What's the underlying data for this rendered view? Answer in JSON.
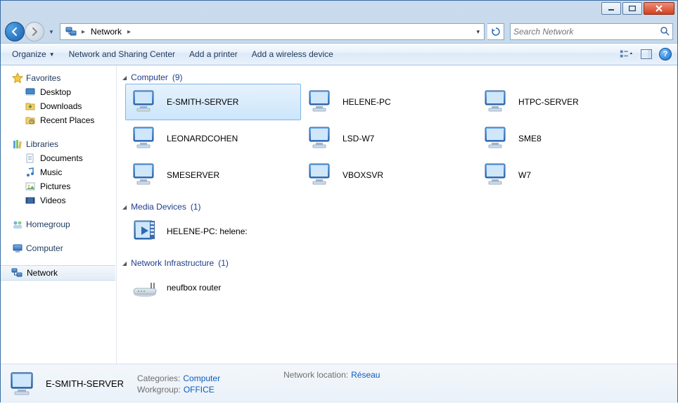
{
  "window": {
    "title": "Network"
  },
  "address": {
    "location": "Network"
  },
  "search": {
    "placeholder": "Search Network"
  },
  "toolbar": {
    "organize": "Organize",
    "nsc": "Network and Sharing Center",
    "add_printer": "Add a printer",
    "add_wireless": "Add a wireless device"
  },
  "sidebar": {
    "favorites": "Favorites",
    "favorites_items": [
      "Desktop",
      "Downloads",
      "Recent Places"
    ],
    "libraries": "Libraries",
    "libraries_items": [
      "Documents",
      "Music",
      "Pictures",
      "Videos"
    ],
    "homegroup": "Homegroup",
    "computer": "Computer",
    "network": "Network"
  },
  "content": {
    "groups": [
      {
        "name": "Computer",
        "count": 9,
        "type": "computer",
        "items": [
          "E-SMITH-SERVER",
          "HELENE-PC",
          "HTPC-SERVER",
          "LEONARDCOHEN",
          "LSD-W7",
          "SME8",
          "SMESERVER",
          "VBOXSVR",
          "W7"
        ],
        "selected": 0
      },
      {
        "name": "Media Devices",
        "count": 1,
        "type": "media",
        "items": [
          "HELENE-PC: helene:"
        ]
      },
      {
        "name": "Network Infrastructure",
        "count": 1,
        "type": "router",
        "items": [
          "neufbox router"
        ]
      }
    ]
  },
  "details": {
    "title": "E-SMITH-SERVER",
    "rows": [
      {
        "k": "Categories:",
        "v": "Computer"
      },
      {
        "k": "Workgroup:",
        "v": "OFFICE"
      },
      {
        "k": "Network location:",
        "v": "Réseau"
      }
    ]
  }
}
